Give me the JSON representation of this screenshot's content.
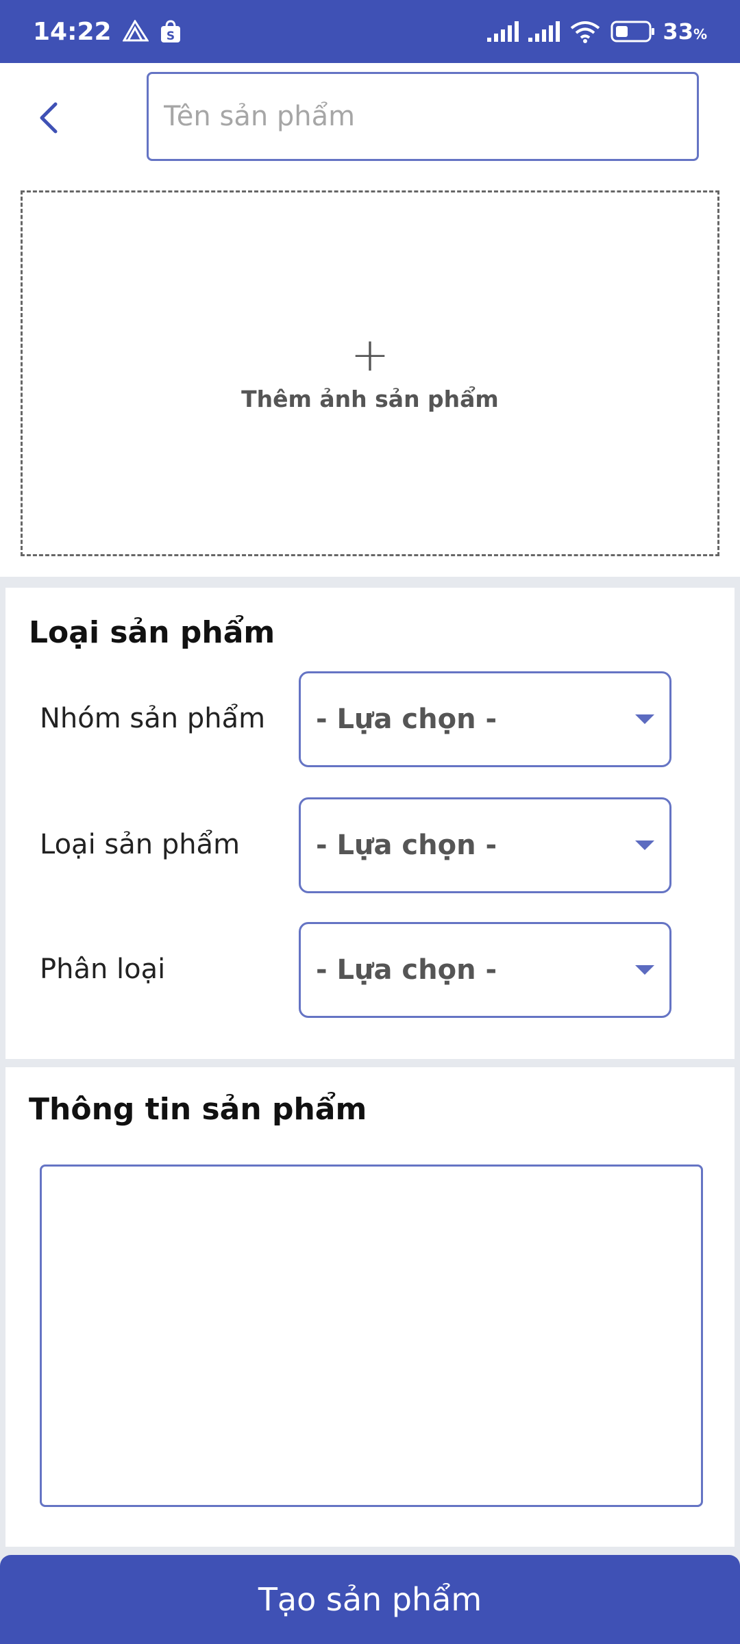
{
  "status_bar": {
    "time": "14:22",
    "battery": "33",
    "battery_unit": "%",
    "icons": [
      "send-app-icon",
      "shopee-icon",
      "signal-icon",
      "signal-icon",
      "wifi-icon",
      "battery-icon"
    ]
  },
  "header": {
    "back_icon": "chevron-left-icon",
    "name_placeholder": "Tên sản phẩm",
    "name_value": ""
  },
  "photo": {
    "plus_icon": "+",
    "label": "Thêm ảnh sản phẩm"
  },
  "category": {
    "title": "Loại sản phẩm",
    "rows": [
      {
        "label": "Nhóm sản phẩm",
        "value": "- Lựa chọn -"
      },
      {
        "label": "Loại sản phẩm",
        "value": "- Lựa chọn -"
      },
      {
        "label": "Phân loại",
        "value": "- Lựa chọn -"
      }
    ]
  },
  "info": {
    "title": "Thông tin sản phẩm",
    "value": ""
  },
  "create_button": "Tạo sản phẩm",
  "colors": {
    "primary": "#3f51b5",
    "border": "#6574c4",
    "background": "#e6e9ee"
  }
}
